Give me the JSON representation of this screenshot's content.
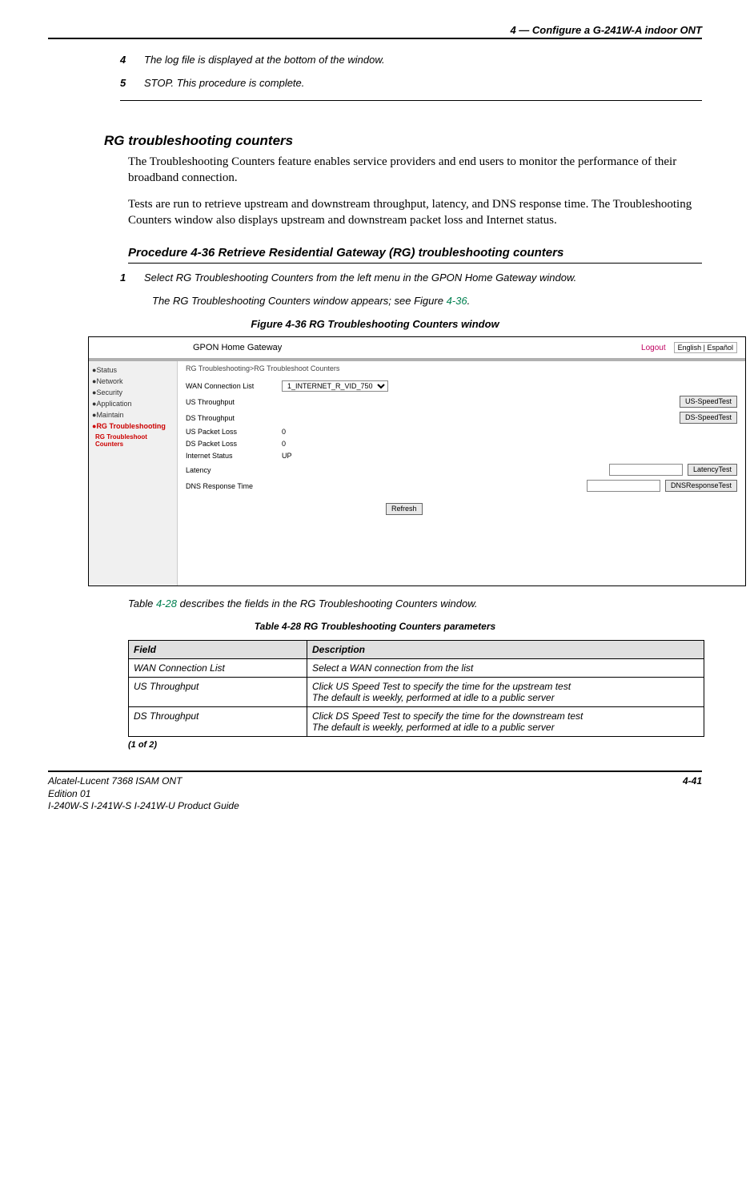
{
  "header": "4 —  Configure a G-241W-A indoor ONT",
  "steps": [
    {
      "num": "4",
      "text": "The log file is displayed at the bottom of the window."
    },
    {
      "num": "5",
      "text": "STOP. This procedure is complete."
    }
  ],
  "section_title": "RG troubleshooting counters",
  "para1": "The Troubleshooting Counters feature enables service providers and end users to monitor the performance of their broadband connection.",
  "para2": "Tests are run to retrieve upstream and downstream throughput, latency, and DNS response time. The Troubleshooting Counters window also displays upstream and downstream packet loss and Internet status.",
  "procedure_title": "Procedure 4-36  Retrieve Residential Gateway (RG) troubleshooting counters",
  "proc_step1_num": "1",
  "proc_step1_text": "Select RG Troubleshooting Counters from the left menu in the GPON Home Gateway window.",
  "proc_step1_sub_a": "The RG Troubleshooting Counters window appears; see Figure ",
  "proc_step1_sub_ref": "4-36",
  "proc_step1_sub_b": ".",
  "figure_caption": "Figure 4-36  RG Troubleshooting Counters window",
  "screenshot": {
    "app_title": "GPON Home Gateway",
    "logout": "Logout",
    "lang": "English | Español",
    "breadcrumb": "RG Troubleshooting>RG Troubleshoot Counters",
    "nav": [
      "Status",
      "Network",
      "Security",
      "Application",
      "Maintain"
    ],
    "nav_active": "RG Troubleshooting",
    "nav_sub": "RG Troubleshoot Counters",
    "rows": {
      "wan_label": "WAN Connection List",
      "wan_value": "1_INTERNET_R_VID_750",
      "usthru_label": "US Throughput",
      "usthru_btn": "US-SpeedTest",
      "dsthru_label": "DS Throughput",
      "dsthru_btn": "DS-SpeedTest",
      "uspkt_label": "US Packet Loss",
      "uspkt_value": "0",
      "dspkt_label": "DS Packet Loss",
      "dspkt_value": "0",
      "istatus_label": "Internet Status",
      "istatus_value": "UP",
      "lat_label": "Latency",
      "lat_btn": "LatencyTest",
      "dns_label": "DNS Response Time",
      "dns_btn": "DNSResponseTest",
      "refresh": "Refresh"
    }
  },
  "after_fig_a": "Table ",
  "after_fig_ref": "4-28",
  "after_fig_b": " describes the fields in the RG Troubleshooting Counters window.",
  "table_caption": "Table 4-28 RG Troubleshooting Counters parameters",
  "table": {
    "h1": "Field",
    "h2": "Description",
    "rows": [
      {
        "f": "WAN Connection List",
        "d": "Select a WAN connection from the list"
      },
      {
        "f": "US Throughput",
        "d": "Click US Speed Test to specify the time for the upstream test\nThe default is weekly, performed at idle to a public server"
      },
      {
        "f": "DS Throughput",
        "d": "Click DS Speed Test to specify the time for the downstream test\nThe default is weekly, performed at idle to a public server"
      }
    ],
    "foot": "(1 of 2)"
  },
  "footer": {
    "line1": "Alcatel-Lucent 7368 ISAM ONT",
    "line2": "Edition 01",
    "line3": "I-240W-S I-241W-S I-241W-U Product Guide",
    "page": "4-41"
  }
}
